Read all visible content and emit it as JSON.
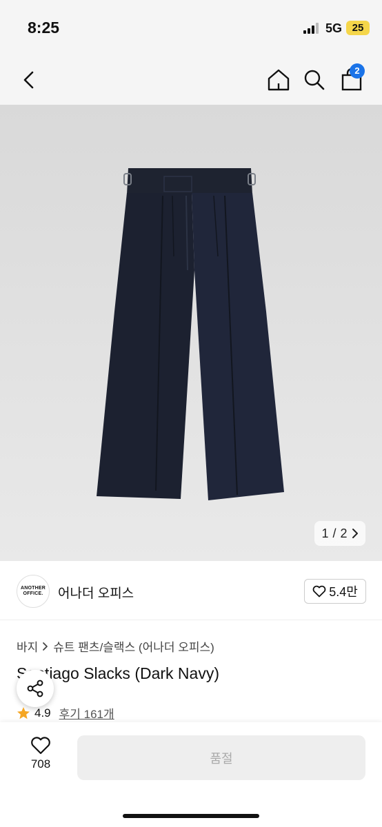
{
  "status_bar": {
    "time": "8:25",
    "network": "5G",
    "battery": "25"
  },
  "nav": {
    "back_icon": "chevron-left-icon",
    "home_icon": "home-icon",
    "search_icon": "search-icon",
    "bag_icon": "shopping-bag-icon",
    "bag_count": "2"
  },
  "gallery": {
    "current": "1",
    "separator": "/",
    "total": "2",
    "next_icon": "chevron-right-icon"
  },
  "brand": {
    "logo_line1": "ANOTHER",
    "logo_line2": "OFFICE.",
    "name": "어나더 오피스",
    "like_count": "5.4만"
  },
  "product": {
    "breadcrumb": [
      "바지",
      "슈트 팬츠/슬랙스 (어나더 오피스)"
    ],
    "title": "Santiago Slacks (Dark Navy)",
    "rating": "4.9",
    "reviews": "후기 161개"
  },
  "bottom": {
    "like_count": "708",
    "buy_label": "품절"
  },
  "colors": {
    "accent_badge": "#1a73e8",
    "star": "#f5a623",
    "pants": "#1e2330"
  }
}
